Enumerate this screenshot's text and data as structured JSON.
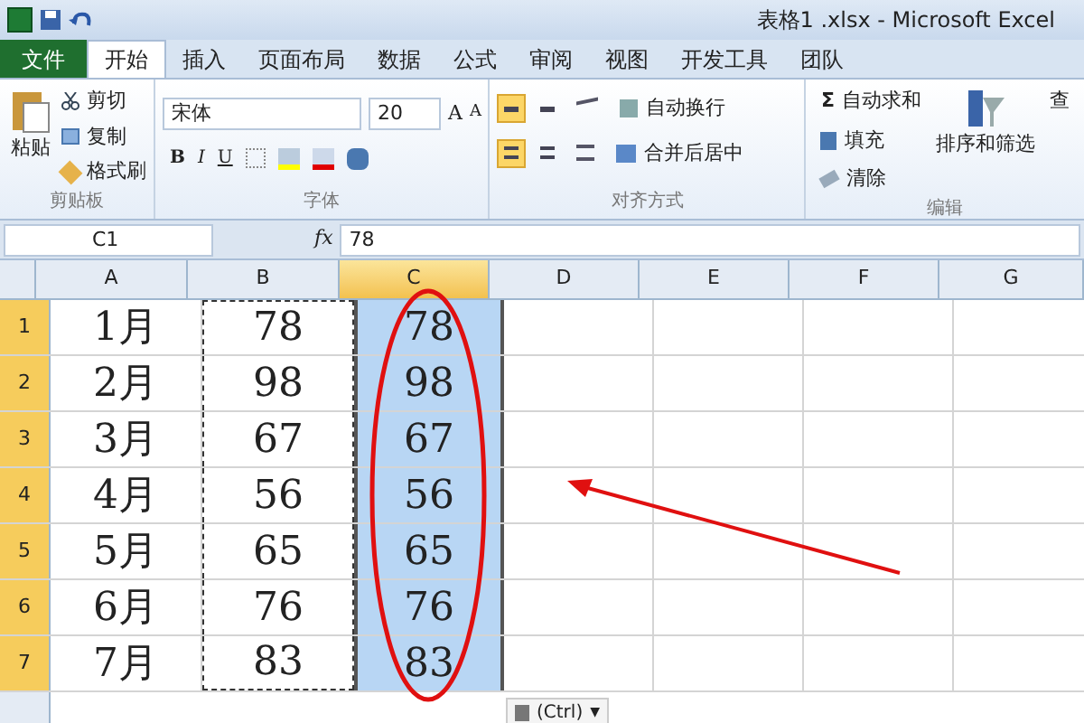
{
  "window": {
    "title": "表格1 .xlsx - Microsoft Excel"
  },
  "tabs": [
    {
      "label": "文件",
      "kind": "file",
      "selected": false
    },
    {
      "label": "开始",
      "kind": "tab",
      "selected": true
    },
    {
      "label": "插入",
      "kind": "tab",
      "selected": false
    },
    {
      "label": "页面布局",
      "kind": "tab",
      "selected": false
    },
    {
      "label": "数据",
      "kind": "tab",
      "selected": false
    },
    {
      "label": "公式",
      "kind": "tab",
      "selected": false
    },
    {
      "label": "审阅",
      "kind": "tab",
      "selected": false
    },
    {
      "label": "视图",
      "kind": "tab",
      "selected": false
    },
    {
      "label": "开发工具",
      "kind": "tab",
      "selected": false
    },
    {
      "label": "团队",
      "kind": "tab",
      "selected": false
    }
  ],
  "clipboard": {
    "label": "剪贴板",
    "paste": "粘贴",
    "cut": "剪切",
    "copy": "复制",
    "format_painter": "格式刷"
  },
  "font": {
    "label": "字体",
    "name": "宋体",
    "size": "20",
    "grow": "A",
    "shrink": "A",
    "bold": "B",
    "italic": "I",
    "underline": "U"
  },
  "alignment": {
    "label": "对齐方式",
    "wrap": "自动换行",
    "merge": "合并后居中",
    "top_buttons": [
      {
        "selected": true
      },
      {
        "selected": false
      }
    ],
    "bottom_buttons": [
      {
        "selected": true
      },
      {
        "selected": false
      }
    ]
  },
  "editing": {
    "label": "编辑",
    "sigma": "Σ",
    "autosum": "自动求和",
    "fill": "填充",
    "clear": "清除",
    "sort": "排序和筛选",
    "find": "查"
  },
  "formula_bar": {
    "name_box": "C1",
    "fx": "fx",
    "value": "78"
  },
  "columns": [
    {
      "label": "A",
      "selected": false,
      "copied": false
    },
    {
      "label": "B",
      "selected": false,
      "copied": true
    },
    {
      "label": "C",
      "selected": true,
      "copied": false
    },
    {
      "label": "D",
      "selected": false,
      "copied": false
    },
    {
      "label": "E",
      "selected": false,
      "copied": false
    },
    {
      "label": "F",
      "selected": false,
      "copied": false
    },
    {
      "label": "G",
      "selected": false,
      "copied": false
    }
  ],
  "rows": [
    {
      "header": "1",
      "selected": true,
      "cells": [
        "1月",
        "78",
        "78"
      ]
    },
    {
      "header": "2",
      "selected": true,
      "cells": [
        "2月",
        "98",
        "98"
      ]
    },
    {
      "header": "3",
      "selected": true,
      "cells": [
        "3月",
        "67",
        "67"
      ]
    },
    {
      "header": "4",
      "selected": true,
      "cells": [
        "4月",
        "56",
        "56"
      ]
    },
    {
      "header": "5",
      "selected": true,
      "cells": [
        "5月",
        "65",
        "65"
      ]
    },
    {
      "header": "6",
      "selected": true,
      "cells": [
        "6月",
        "76",
        "76"
      ]
    },
    {
      "header": "7",
      "selected": true,
      "cells": [
        "7月",
        "83",
        "83"
      ]
    }
  ],
  "paste_options": {
    "label": "(Ctrl)",
    "caret": "▼"
  }
}
